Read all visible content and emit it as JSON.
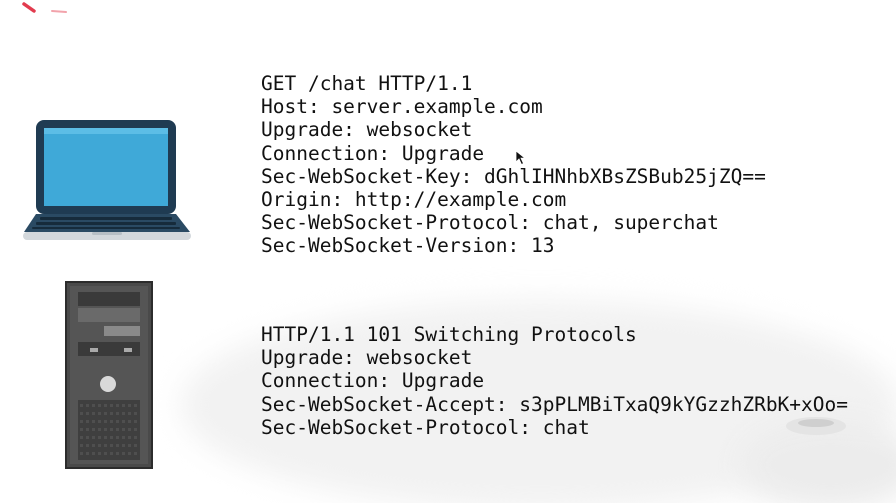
{
  "request": {
    "lines": [
      "GET /chat HTTP/1.1",
      "Host: server.example.com",
      "Upgrade: websocket",
      "Connection: Upgrade",
      "Sec-WebSocket-Key: dGhlIHNhbXBsZSBub25jZQ==",
      "Origin: http://example.com",
      "Sec-WebSocket-Protocol: chat, superchat",
      "Sec-WebSocket-Version: 13"
    ]
  },
  "response": {
    "lines": [
      "HTTP/1.1 101 Switching Protocols",
      "Upgrade: websocket",
      "Connection: Upgrade",
      "Sec-WebSocket-Accept: s3pPLMBiTxaQ9kYGzzhZRbK+xOo=",
      "Sec-WebSocket-Protocol: chat"
    ]
  },
  "icons": {
    "client": "laptop-icon",
    "server": "server-tower-icon",
    "pointer": "mouse-cursor-icon"
  },
  "colors": {
    "text": "#111111",
    "laptop_frame": "#1f3b52",
    "laptop_screen": "#3fa9d8",
    "server_body": "#4a4a4a",
    "corner_mark": "#e23b4e"
  }
}
